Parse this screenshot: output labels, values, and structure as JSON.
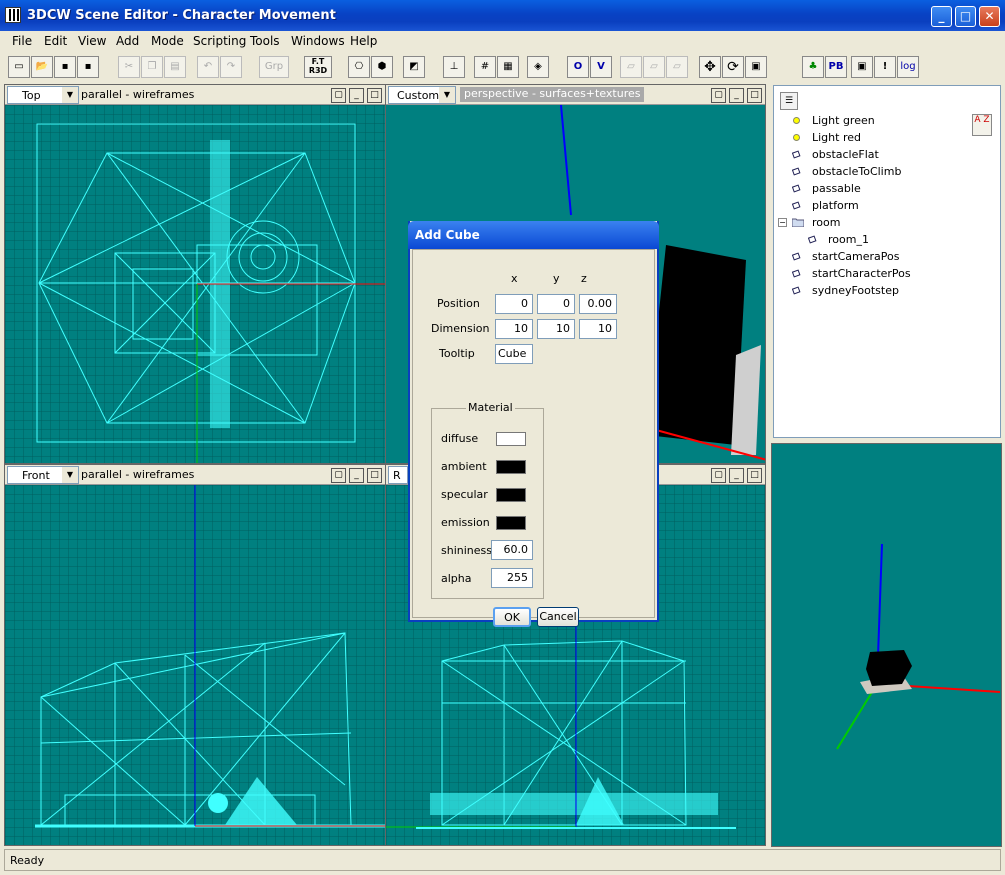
{
  "app": {
    "title": "3DCW Scene Editor - Character Movement",
    "window_buttons": [
      "_",
      "□",
      "✕"
    ]
  },
  "menu": [
    "File",
    "Edit",
    "View",
    "Add",
    "Mode",
    "Scripting",
    "Tools",
    "Windows",
    "Help"
  ],
  "toolbar": {
    "grp_label": "Grp",
    "rt_label": "F.T R3D",
    "o_label": "O",
    "v_label": "V",
    "pb_label": "PB",
    "log_label": "log",
    "excl_label": "!"
  },
  "viewports": {
    "top_left": {
      "view": "Top",
      "mode": "parallel - wireframes"
    },
    "top_right": {
      "view": "Custom",
      "mode": "perspective - surfaces+textures"
    },
    "bottom_left": {
      "view": "Front",
      "mode": "parallel - wireframes"
    },
    "bottom_right": {
      "view": "R",
      "mode": ""
    }
  },
  "tree": {
    "items": [
      {
        "label": "Light green",
        "icon": "light-icon"
      },
      {
        "label": "Light red",
        "icon": "light-icon"
      },
      {
        "label": "obstacleFlat",
        "icon": "object-icon"
      },
      {
        "label": "obstacleToClimb",
        "icon": "object-icon"
      },
      {
        "label": "passable",
        "icon": "object-icon"
      },
      {
        "label": "platform",
        "icon": "object-icon"
      },
      {
        "label": "room",
        "icon": "folder-icon"
      },
      {
        "label": "room_1",
        "icon": "object-icon"
      },
      {
        "label": "startCameraPos",
        "icon": "object-icon"
      },
      {
        "label": "startCharacterPos",
        "icon": "object-icon"
      },
      {
        "label": "sydneyFootstep",
        "icon": "object-icon"
      }
    ],
    "sort_label": "A Z"
  },
  "dialog": {
    "title": "Add Cube",
    "col_x": "x",
    "col_y": "y",
    "col_z": "z",
    "position_label": "Position",
    "position": [
      "0",
      "0",
      "0.00"
    ],
    "dimension_label": "Dimension",
    "dimension": [
      "10",
      "10",
      "10"
    ],
    "tooltip_label": "Tooltip",
    "tooltip": "Cube",
    "material_label": "Material",
    "diffuse_label": "diffuse",
    "ambient_label": "ambient",
    "specular_label": "specular",
    "emission_label": "emission",
    "shininess_label": "shininess",
    "shininess": "60.0",
    "alpha_label": "alpha",
    "alpha": "255",
    "ok_label": "OK",
    "cancel_label": "Cancel",
    "colors": {
      "diffuse": "#ffffff",
      "ambient": "#000000",
      "specular": "#000000",
      "emission": "#000000"
    }
  },
  "status": {
    "text": "Ready"
  },
  "colors": {
    "viewport_bg": "#008080",
    "wire": "#40ffff",
    "axis_x": "#ff0000",
    "axis_y": "#00cc00",
    "axis_z": "#0000ff"
  }
}
